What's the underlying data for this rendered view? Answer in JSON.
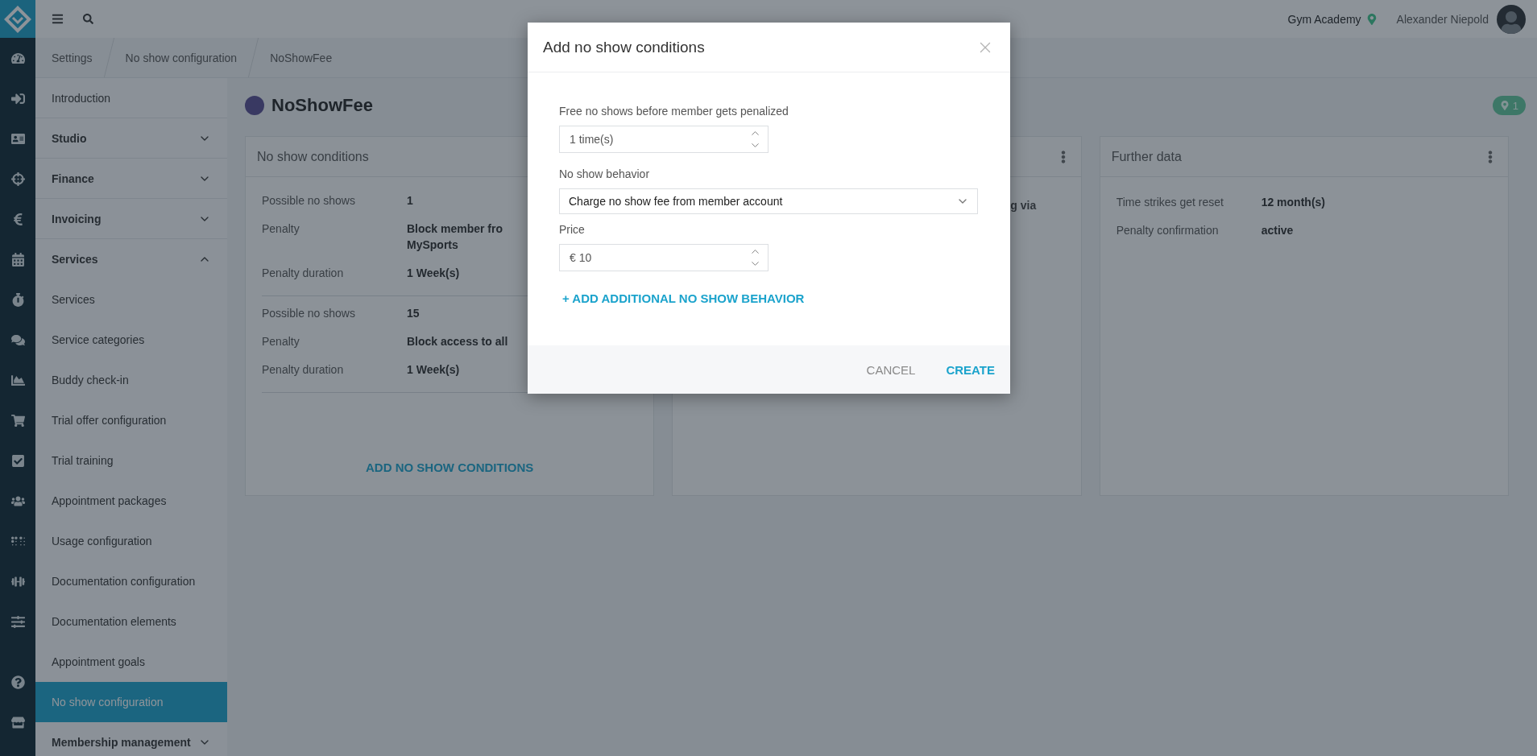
{
  "topbar": {
    "studio": "Gym Academy",
    "user": "Alexander Niepold"
  },
  "breadcrumb": [
    "Settings",
    "No show configuration",
    "NoShowFee"
  ],
  "sidebar": {
    "items": [
      {
        "kind": "link",
        "label": "Introduction",
        "selected": false
      },
      {
        "kind": "section",
        "label": "Studio",
        "expanded": false
      },
      {
        "kind": "section",
        "label": "Finance",
        "expanded": false
      },
      {
        "kind": "section",
        "label": "Invoicing",
        "expanded": false
      },
      {
        "kind": "section",
        "label": "Services",
        "expanded": true,
        "children": [
          {
            "label": "Services",
            "selected": false
          },
          {
            "label": "Service categories",
            "selected": false
          },
          {
            "label": "Buddy check-in",
            "selected": false
          },
          {
            "label": "Trial offer configuration",
            "selected": false
          },
          {
            "label": "Trial training",
            "selected": false
          },
          {
            "label": "Appointment packages",
            "selected": false
          },
          {
            "label": "Usage configuration",
            "selected": false
          },
          {
            "label": "Documentation configuration",
            "selected": false
          },
          {
            "label": "Documentation elements",
            "selected": false
          },
          {
            "label": "Appointment goals",
            "selected": false
          },
          {
            "label": "No show configuration",
            "selected": true
          }
        ]
      },
      {
        "kind": "section",
        "label": "Membership management",
        "expanded": false
      }
    ]
  },
  "page": {
    "title": "NoShowFee",
    "location_count": "1"
  },
  "cards": [
    {
      "kind": "conditions",
      "title": "No show conditions",
      "groups": [
        {
          "rows": [
            {
              "label": "Possible no shows",
              "value": "1"
            },
            {
              "label": "Penalty",
              "value": "Block member fro\nMySports"
            },
            {
              "label": "Penalty duration",
              "value": "1 Week(s)"
            }
          ]
        },
        {
          "rows": [
            {
              "label": "Possible no shows",
              "value": "15"
            },
            {
              "label": "Penalty",
              "value": "Block access to all"
            },
            {
              "label": "Penalty duration",
              "value": "1 Week(s)"
            }
          ]
        }
      ],
      "action": "ADD NO SHOW CONDITIONS"
    },
    {
      "kind": "covered",
      "has_menu": true,
      "visible_text": "g via"
    },
    {
      "kind": "details",
      "title": "Further data",
      "has_menu": true,
      "rows": [
        {
          "label": "Time strikes get reset",
          "value": "12 month(s)"
        },
        {
          "label": "Penalty confirmation",
          "value": "active"
        }
      ]
    }
  ],
  "dialog": {
    "title": "Add no show conditions",
    "fields": [
      {
        "kind": "number",
        "label": "Free no shows before member gets penalized",
        "value": "1 time(s)"
      },
      {
        "kind": "select",
        "label": "No show behavior",
        "value": "Charge no show fee from member account"
      },
      {
        "kind": "number",
        "label": "Price",
        "value": "€ 10"
      }
    ],
    "add_link": "+ ADD ADDITIONAL NO SHOW BEHAVIOR",
    "buttons": [
      {
        "kind": "secondary",
        "label": "CANCEL"
      },
      {
        "kind": "primary",
        "label": "CREATE"
      }
    ]
  }
}
